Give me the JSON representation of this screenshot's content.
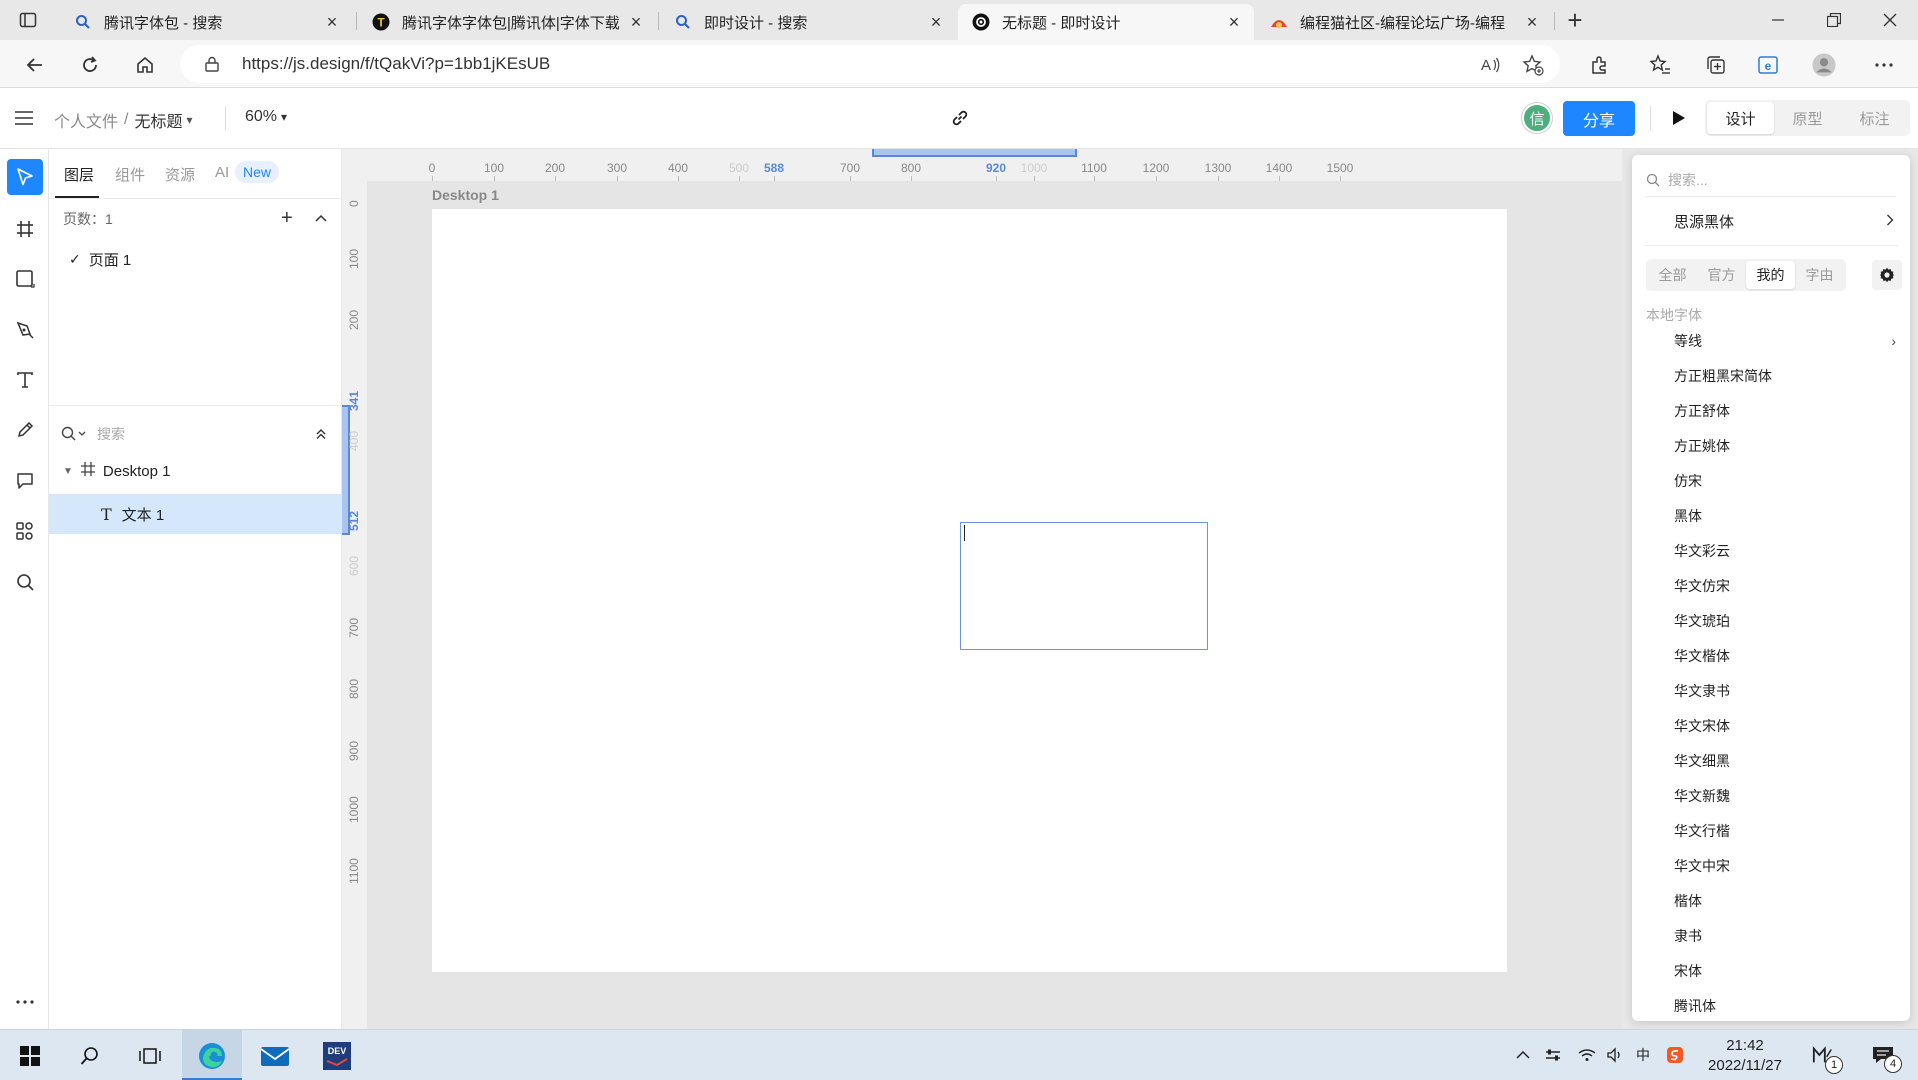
{
  "browser": {
    "tabs": [
      {
        "label": "腾讯字体包 - 搜索",
        "icon": "search-icon"
      },
      {
        "label": "腾讯字体字体包|腾讯体|字体下载",
        "icon": "t-logo-icon"
      },
      {
        "label": "即时设计 - 搜索",
        "icon": "search-icon"
      },
      {
        "label": "无标题 - 即时设计",
        "icon": "jsdesign-logo-icon",
        "active": true
      },
      {
        "label": "编程猫社区-编程论坛广场-编程",
        "icon": "codemao-logo-icon"
      }
    ],
    "url": "https://js.design/f/tQakVi?p=1bb1jKEsUB"
  },
  "header": {
    "breadcrumb_parent": "个人文件",
    "breadcrumb_sep": "/",
    "file_name": "无标题",
    "zoom": "60%",
    "avatar_text": "信",
    "share_label": "分享",
    "modes": [
      "设计",
      "原型",
      "标注"
    ],
    "active_mode": "设计"
  },
  "layers_panel": {
    "tabs": [
      "图层",
      "组件",
      "资源",
      "AI"
    ],
    "new_badge": "New",
    "pages_label": "页数：1",
    "page_name": "页面 1",
    "search_placeholder": "搜索",
    "frame_name": "Desktop 1",
    "text_layer_name": "文本 1"
  },
  "canvas": {
    "frame_label": "Desktop 1",
    "ruler_top": [
      {
        "v": "0"
      },
      {
        "v": "100"
      },
      {
        "v": "200"
      },
      {
        "v": "300"
      },
      {
        "v": "400"
      },
      {
        "v": "500",
        "faint": true
      },
      {
        "v": "588",
        "sel": true
      },
      {
        "v": "700"
      },
      {
        "v": "800"
      },
      {
        "v": "920",
        "sel": true
      },
      {
        "v": "1000",
        "faint": true
      },
      {
        "v": "1100"
      },
      {
        "v": "1200"
      },
      {
        "v": "1300"
      },
      {
        "v": "1400"
      },
      {
        "v": "1500"
      }
    ],
    "ruler_left": [
      {
        "v": "0"
      },
      {
        "v": "100"
      },
      {
        "v": "200"
      },
      {
        "v": "341",
        "sel": true
      },
      {
        "v": "400",
        "faint": true
      },
      {
        "v": "512",
        "sel": true
      },
      {
        "v": "600",
        "faint": true
      },
      {
        "v": "700"
      },
      {
        "v": "800"
      },
      {
        "v": "900"
      },
      {
        "v": "1000"
      },
      {
        "v": "1100"
      }
    ]
  },
  "font_panel": {
    "search_placeholder": "搜索...",
    "current_font": "思源黑体",
    "tabs": [
      "全部",
      "官方",
      "我的",
      "字由"
    ],
    "active_tab": "我的",
    "section_label": "本地字体",
    "fonts": [
      {
        "name": "等线",
        "has_sub": true
      },
      {
        "name": "方正粗黑宋简体"
      },
      {
        "name": "方正舒体"
      },
      {
        "name": "方正姚体"
      },
      {
        "name": "仿宋"
      },
      {
        "name": "黑体"
      },
      {
        "name": "华文彩云"
      },
      {
        "name": "华文仿宋"
      },
      {
        "name": "华文琥珀"
      },
      {
        "name": "华文楷体"
      },
      {
        "name": "华文隶书"
      },
      {
        "name": "华文宋体"
      },
      {
        "name": "华文细黑"
      },
      {
        "name": "华文新魏"
      },
      {
        "name": "华文行楷"
      },
      {
        "name": "华文中宋"
      },
      {
        "name": "楷体"
      },
      {
        "name": "隶书"
      },
      {
        "name": "宋体"
      },
      {
        "name": "腾讯体"
      }
    ]
  },
  "taskbar": {
    "time": "21:42",
    "date": "2022/11/27",
    "notification_count": "4",
    "tray_badge": "1"
  },
  "colors": {
    "accent": "#1e87ff",
    "selection": "#5b87d9",
    "avatar": "#4caf7d",
    "layer_highlight": "#d4e7fb"
  }
}
